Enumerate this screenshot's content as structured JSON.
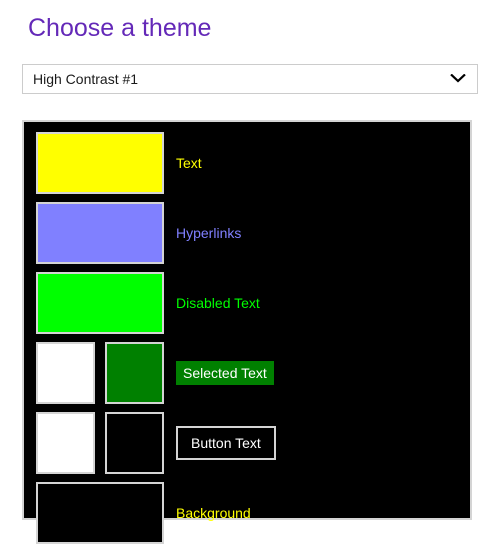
{
  "page": {
    "title": "Choose a theme",
    "title_color": "#6429b8"
  },
  "theme_select": {
    "name": "theme-dropdown",
    "selected_value": "High Contrast #1",
    "placeholder": "Choose a theme",
    "chevron_icon": "chevron-down-icon",
    "options": [
      "High Contrast #1"
    ]
  },
  "preview": {
    "panel_background": "#000000",
    "panel_border_color": "#d4d4d4",
    "rows": [
      {
        "key": "text",
        "label": "Text",
        "label_color": "#ffff00",
        "label_background": "transparent",
        "label_style": "plain",
        "swatches": [
          {
            "color": "#ffff00",
            "shape": "wide"
          }
        ]
      },
      {
        "key": "hyperlinks",
        "label": "Hyperlinks",
        "label_color": "#8080ff",
        "label_background": "transparent",
        "label_style": "plain",
        "swatches": [
          {
            "color": "#8080ff",
            "shape": "wide"
          }
        ]
      },
      {
        "key": "disabled-text",
        "label": "Disabled Text",
        "label_color": "#00ff00",
        "label_background": "transparent",
        "label_style": "plain",
        "swatches": [
          {
            "color": "#00ff00",
            "shape": "wide"
          }
        ]
      },
      {
        "key": "selected-text",
        "label": "Selected Text",
        "label_color": "#ffffff",
        "label_background": "#008000",
        "label_style": "selected",
        "swatches": [
          {
            "color": "#ffffff",
            "shape": "square"
          },
          {
            "color": "#008000",
            "shape": "square"
          }
        ]
      },
      {
        "key": "button-text",
        "label": "Button Text",
        "label_color": "#ffffff",
        "label_background": "#000000",
        "label_style": "button",
        "swatches": [
          {
            "color": "#ffffff",
            "shape": "square"
          },
          {
            "color": "#000000",
            "shape": "square"
          }
        ]
      },
      {
        "key": "background",
        "label": "Background",
        "label_color": "#ffff00",
        "label_background": "transparent",
        "label_style": "plain",
        "swatches": [
          {
            "color": "#000000",
            "shape": "wide"
          }
        ]
      }
    ]
  }
}
